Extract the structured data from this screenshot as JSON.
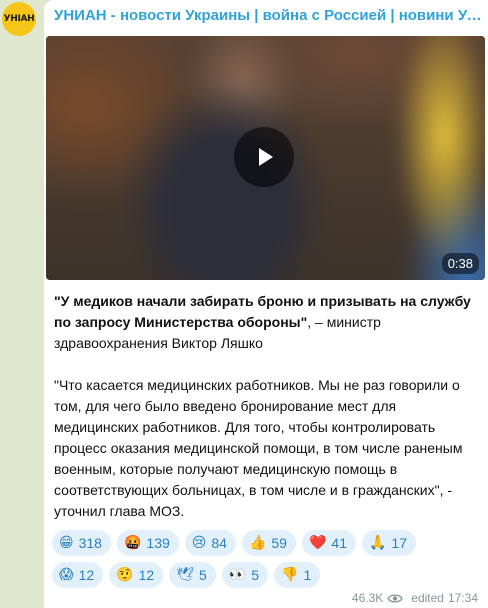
{
  "channel": {
    "avatar_text": "УНІАН",
    "title": "УНИАН - новости Украины | война с Россией | новини України..."
  },
  "video": {
    "duration": "0:38"
  },
  "post": {
    "p1_bold": "\"У медиков начали забирать броню и призывать на службу по запросу Министерства обороны\"",
    "p1_rest": ", – министр здравоохранения Виктор Ляшко",
    "p2": "\"Что касается медицинских работников. Мы не раз говорили о том, для чего было введено бронирование мест для медицинских работников. Для того, чтобы контролировать процесс оказания медицинской помощи, в том числе раненым военным, которые получают медицинскую помощь в соответствующих больницах, в том числе и в гражданских\", - уточнил глава МОЗ."
  },
  "reactions": {
    "row1": [
      {
        "emoji": "😁",
        "count": "318"
      },
      {
        "emoji": "🤬",
        "count": "139"
      },
      {
        "emoji": "😢",
        "count": "84"
      },
      {
        "emoji": "👍",
        "count": "59"
      },
      {
        "emoji": "❤️",
        "count": "41"
      },
      {
        "emoji": "🙏",
        "count": "17"
      }
    ],
    "row2": [
      {
        "emoji": "😱",
        "count": "12"
      },
      {
        "emoji": "🤨",
        "count": "12"
      },
      {
        "emoji": "🕊",
        "count": "5"
      },
      {
        "emoji": "👀",
        "count": "5"
      },
      {
        "emoji": "👎",
        "count": "1"
      }
    ]
  },
  "meta": {
    "views": "46.3K",
    "edited": "edited",
    "time": "17:34"
  },
  "colors": {
    "accent": "#2fa3d9",
    "reaction_bg": "#e1f0fb",
    "reaction_text": "#2a7fc0",
    "chat_bg": "#dfe8cf"
  }
}
